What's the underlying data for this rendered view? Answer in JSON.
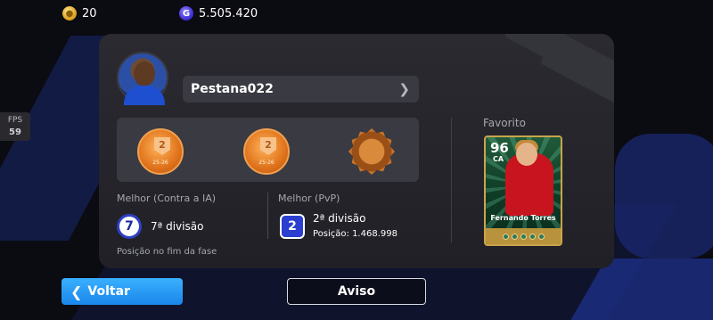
{
  "top": {
    "coins_icon": "coin-icon",
    "coins": "20",
    "gp_icon": "gp-icon",
    "gp_letter": "G",
    "gp": "5.505.420"
  },
  "fps": {
    "label": "FPS",
    "value": "59"
  },
  "profile": {
    "name": "Pestana022",
    "avatar_icon": "player-avatar"
  },
  "medals": [
    {
      "rank": "2",
      "season": "25-26"
    },
    {
      "rank": "2",
      "season": "25-26"
    },
    {
      "icon": "gear-medal-icon"
    }
  ],
  "best_ai": {
    "label": "Melhor (Contra a IA)",
    "rank": "7",
    "division": "7ª divisão",
    "note": "Posição no fim da fase"
  },
  "best_pvp": {
    "label": "Melhor (PvP)",
    "rank": "2",
    "division": "2ª divisão",
    "position": "Posição: 1.468.998"
  },
  "favorite": {
    "label": "Favorito",
    "ovr": "96",
    "position": "CA",
    "player": "Fernando Torres"
  },
  "buttons": {
    "back": "Voltar",
    "notice": "Aviso"
  },
  "colors": {
    "accent_blue": "#1a86ea",
    "panel": "#2a2a30",
    "card_gold": "#c9a44a"
  }
}
